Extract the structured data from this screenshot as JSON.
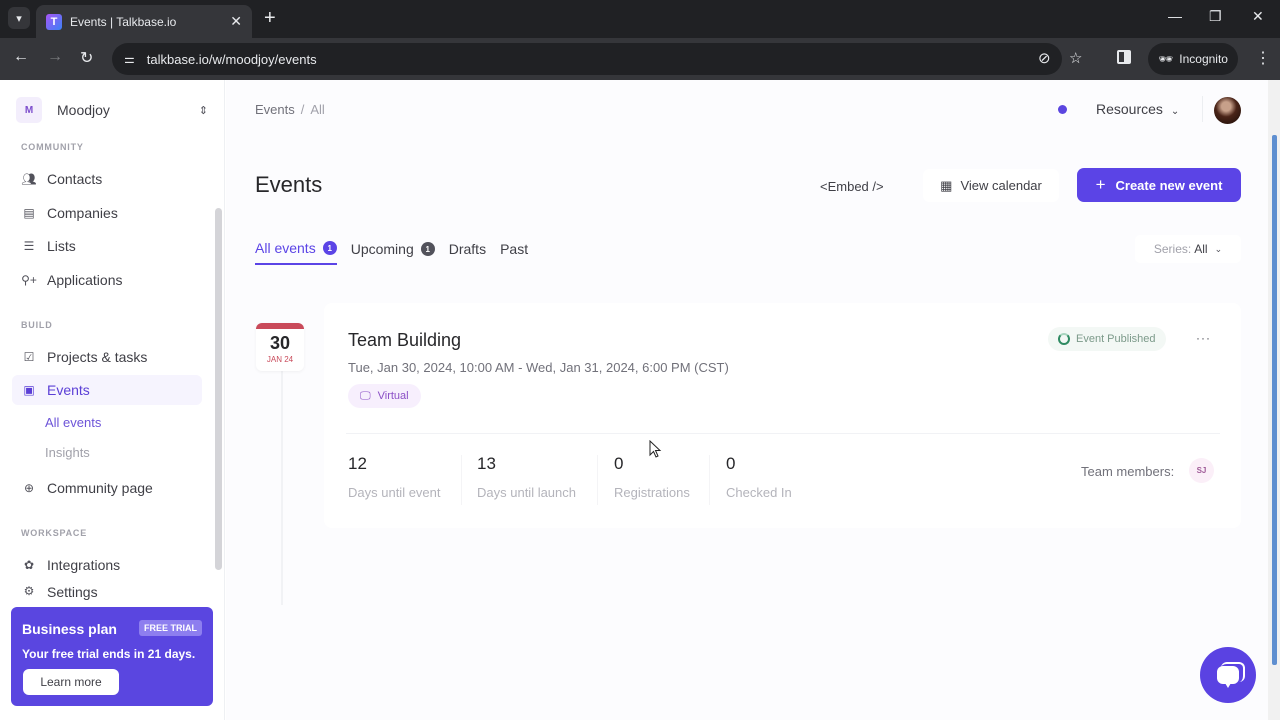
{
  "browser": {
    "tab_title": "Events | Talkbase.io",
    "favicon_letter": "T",
    "url": "talkbase.io/w/moodjoy/events",
    "incognito_label": "Incognito",
    "icons": {
      "tab_list": "chevron-down-icon",
      "tab_close": "close-icon",
      "new_tab": "plus-icon",
      "back": "arrow-left-icon",
      "forward": "arrow-right-icon",
      "reload": "reload-icon",
      "site_settings": "tune-icon",
      "tracking": "eye-off-icon",
      "bookmark": "star-icon",
      "side_panel": "side-panel-icon",
      "menu": "kebab-menu-icon"
    }
  },
  "sidebar": {
    "workspace": {
      "initial": "M",
      "name": "Moodjoy"
    },
    "sections": [
      {
        "label": "COMMUNITY"
      },
      {
        "label": "BUILD"
      },
      {
        "label": "WORKSPACE"
      }
    ],
    "items": [
      {
        "label": "Contacts",
        "icon": "users-icon"
      },
      {
        "label": "Companies",
        "icon": "building-icon"
      },
      {
        "label": "Lists",
        "icon": "list-icon"
      },
      {
        "label": "Applications",
        "icon": "user-plus-icon"
      },
      {
        "label": "Projects & tasks",
        "icon": "checkbox-icon"
      },
      {
        "label": "Events",
        "icon": "calendar-icon",
        "active": true
      },
      {
        "label": "Community page",
        "icon": "globe-icon"
      },
      {
        "label": "Integrations",
        "icon": "puzzle-icon"
      },
      {
        "label": "Settings",
        "icon": "gear-icon"
      }
    ],
    "sub_items": [
      {
        "label": "All events",
        "active": true
      },
      {
        "label": "Insights"
      }
    ],
    "trial": {
      "title": "Business plan",
      "badge": "FREE TRIAL",
      "text": "Your free trial ends in 21 days.",
      "button": "Learn more"
    }
  },
  "header": {
    "breadcrumb": [
      "Events",
      "All"
    ],
    "breadcrumb_sep": "/",
    "resources_label": "Resources"
  },
  "main": {
    "title": "Events",
    "embed_label": "<Embed />",
    "calendar_label": "View calendar",
    "create_label": "Create new event",
    "tabs": [
      {
        "label": "All events",
        "count": "1",
        "active": true
      },
      {
        "label": "Upcoming",
        "count": "1"
      },
      {
        "label": "Drafts"
      },
      {
        "label": "Past"
      }
    ],
    "series_filter": {
      "label": "Series:",
      "value": "All"
    },
    "events": [
      {
        "day": "30",
        "month_year": "JAN 24",
        "title": "Team Building",
        "dates": "Tue, Jan 30, 2024, 10:00 AM - Wed, Jan 31, 2024, 6:00 PM (CST)",
        "location_type": "Virtual",
        "status": "Event Published",
        "more": "···",
        "stats": [
          {
            "value": "12",
            "label": "Days until event"
          },
          {
            "value": "13",
            "label": "Days until launch"
          },
          {
            "value": "0",
            "label": "Registrations"
          },
          {
            "value": "0",
            "label": "Checked In"
          }
        ],
        "team_label": "Team members:",
        "team_members": [
          "SJ"
        ]
      }
    ]
  },
  "colors": {
    "accent": "#5b44e6",
    "date_accent": "#c94a5a",
    "published_green": "#2f8a62"
  }
}
